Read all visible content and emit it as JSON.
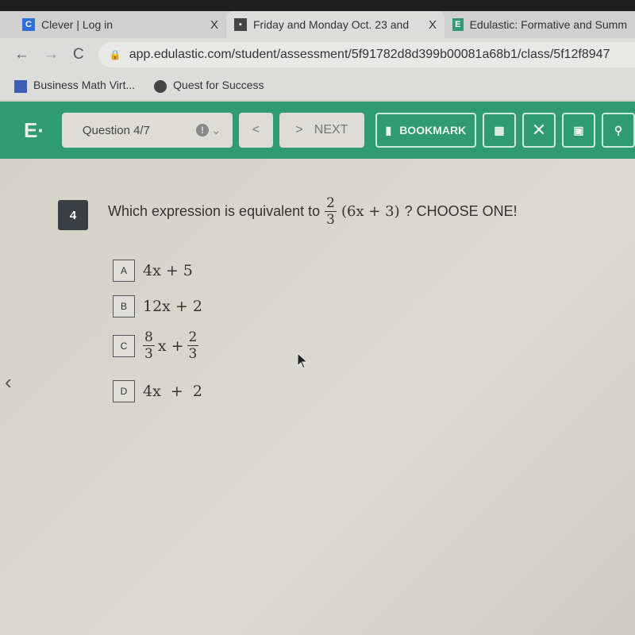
{
  "browser": {
    "tabs": [
      {
        "title": "Clever | Log in",
        "favicon": "C",
        "favicon_color": "#2f6fdc",
        "close": "X"
      },
      {
        "title": "Friday and Monday Oct. 23 and",
        "favicon": "classroom-icon",
        "favicon_color": "#444444",
        "close": "X"
      },
      {
        "title": "Edulastic: Formative and Summ",
        "favicon": "E",
        "favicon_color": "#2f9a73"
      }
    ],
    "url": "app.edulastic.com/student/assessment/5f91782d8d399b00081a68b1/class/5f12f8947",
    "bookmarks": [
      {
        "label": "Business Math Virt...",
        "icon": "calendar-icon"
      },
      {
        "label": "Quest for Success",
        "icon": "globe-icon"
      }
    ]
  },
  "toolbar": {
    "logo": "E·",
    "question_selector": "Question 4/7",
    "warn_icon": "!",
    "prev_label": "<",
    "next_label": "NEXT",
    "bookmark_label": "BOOKMARK",
    "accent": "#2f9a73"
  },
  "question": {
    "number": "4",
    "prompt": "Which expression is equivalent to",
    "expr": {
      "num": "2",
      "den": "3",
      "rest": "(6x + 3)"
    },
    "suffix": "? CHOOSE ONE!",
    "options": [
      {
        "label": "A",
        "text": "4x + 5"
      },
      {
        "label": "B",
        "text": "12x + 2"
      },
      {
        "label": "C",
        "f1": {
          "num": "8",
          "den": "3"
        },
        "mid": "x +",
        "f2": {
          "num": "2",
          "den": "3"
        }
      },
      {
        "label": "D",
        "text": "4x  +  2"
      }
    ]
  }
}
